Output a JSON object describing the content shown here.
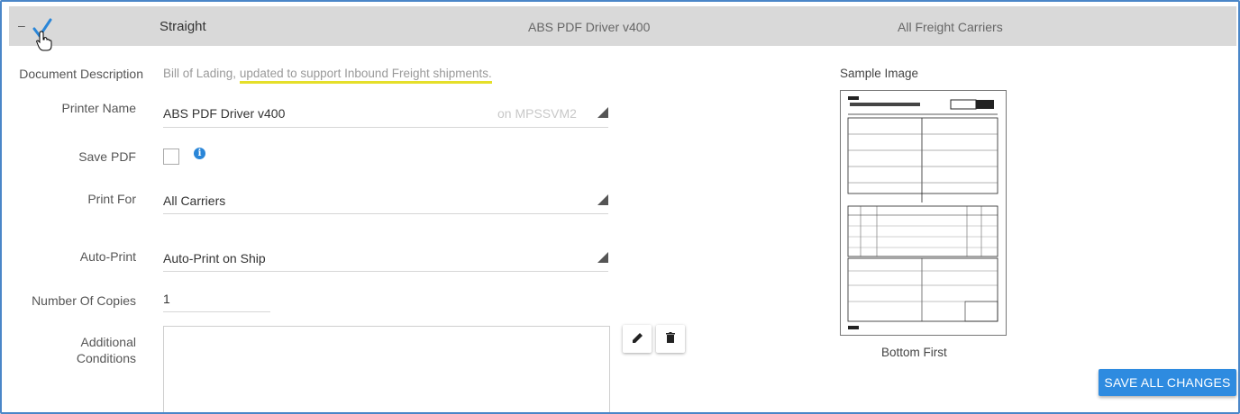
{
  "header": {
    "collapse_symbol": "–",
    "document_type": "Straight",
    "printer": "ABS PDF Driver v400",
    "carrier": "All Freight Carriers"
  },
  "form": {
    "document_description": {
      "label": "Document Description",
      "value_plain": "Bill of Lading, ",
      "value_highlight": "updated to support Inbound Freight shipments."
    },
    "printer_name": {
      "label": "Printer Name",
      "value": "ABS PDF Driver v400",
      "location": "on MPSSVM2"
    },
    "save_pdf": {
      "label": "Save PDF",
      "checked": false,
      "info_symbol": "i"
    },
    "print_for": {
      "label": "Print For",
      "value": "All Carriers"
    },
    "auto_print": {
      "label": "Auto-Print",
      "value": "Auto-Print on Ship"
    },
    "number_of_copies": {
      "label": "Number Of Copies",
      "value": "1"
    },
    "additional_conditions": {
      "label_line1": "Additional",
      "label_line2": "Conditions",
      "value": ""
    }
  },
  "sample": {
    "title": "Sample Image",
    "caption": "Bottom First"
  },
  "actions": {
    "save_all": "SAVE ALL CHANGES"
  },
  "colors": {
    "accent": "#2e8be0",
    "header_bg": "#d9d9d9",
    "highlight": "#e5df2a",
    "check": "#2a86d8"
  },
  "icons": [
    "check-icon",
    "cursor-hand-icon",
    "dropdown-arrow-icon",
    "info-icon",
    "edit-icon",
    "delete-icon"
  ]
}
